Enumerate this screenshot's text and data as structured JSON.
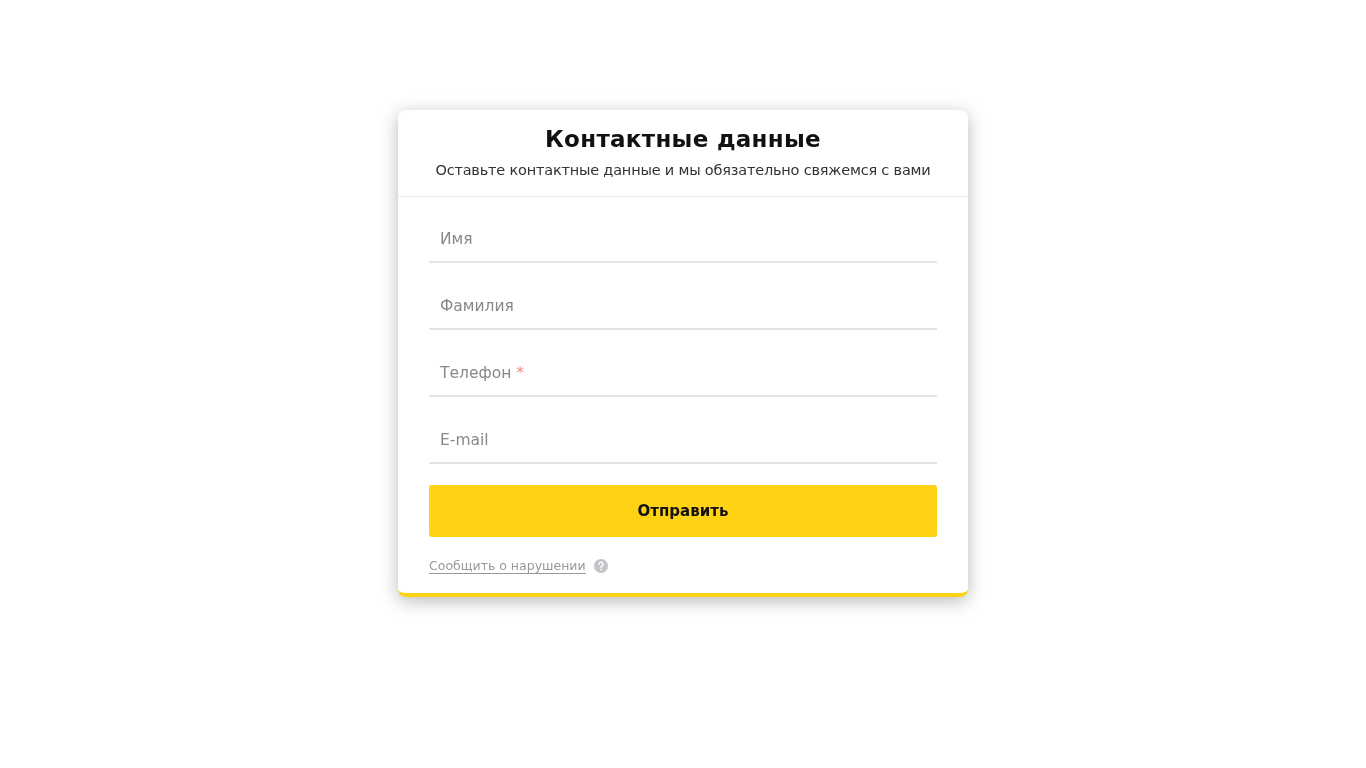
{
  "form": {
    "title": "Контактные данные",
    "subtitle": "Оставьте контактные данные и мы обязательно свяжемся с вами",
    "fields": [
      {
        "label": "Имя"
      },
      {
        "label": "Фамилия"
      },
      {
        "label": "Телефон",
        "required_mark": "*"
      },
      {
        "label": "E-mail"
      }
    ],
    "submit": "Отправить",
    "report_link": "Сообщить о нарушении"
  }
}
